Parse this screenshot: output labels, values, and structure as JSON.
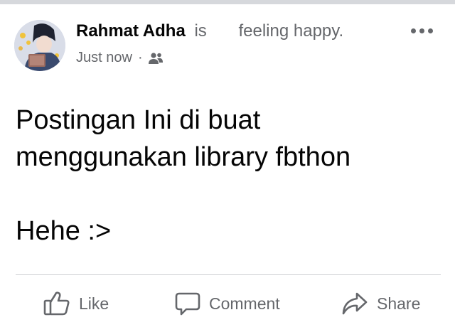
{
  "post": {
    "author": "Rahmat Adha",
    "is_word": "is",
    "feeling": "feeling happy.",
    "timestamp": "Just now",
    "separator": "·",
    "audience_icon": "friends-icon",
    "more_icon": "more-options-icon",
    "body_line1": "Postingan Ini di buat",
    "body_line2": "menggunakan library fbthon",
    "body_line3": "Hehe :>"
  },
  "actions": {
    "like_label": "Like",
    "like_icon": "thumbs-up-icon",
    "comment_label": "Comment",
    "comment_icon": "comment-bubble-icon",
    "share_label": "Share",
    "share_icon": "share-arrow-icon"
  },
  "colors": {
    "text_primary": "#050505",
    "text_secondary": "#65676b",
    "divider": "#ced0d4"
  }
}
